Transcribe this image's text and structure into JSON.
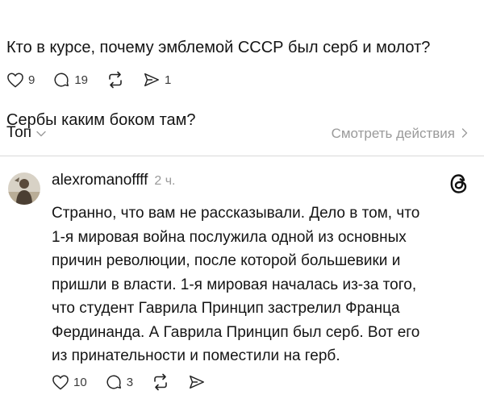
{
  "post": {
    "text_lines": [
      "Кто в курсе, почему эмблемой СССР был серб и молот?",
      "Сербы каким боком там?"
    ],
    "like_count": "9",
    "reply_count": "19",
    "share_count": "1"
  },
  "replies_header": {
    "sort_label": "Топ",
    "view_activity": "Смотреть действия"
  },
  "comment": {
    "username": "alexromanoffff",
    "timestamp": "2 ч.",
    "text_lines": [
      "Странно, что вам не рассказывали. Дело в том, что",
      "1-я мировая война послужила одной из основных",
      "причин революции, после которой большевики и",
      "пришли в власти. 1-я мировая началась из-за того,",
      "что студент Гаврила Принцип застрелил Франца",
      "Фердинанда. А Гаврила Принцип был серб. Вот его",
      "из принательности и поместили на герб."
    ],
    "like_count": "10",
    "reply_count": "3"
  },
  "icons": {
    "like": "heart-icon",
    "reply": "comment-bubble-icon",
    "repost": "repost-icon",
    "share": "send-icon",
    "threads": "threads-logo-icon",
    "chevron_down": "chevron-down-icon",
    "chevron_right": "chevron-right-icon"
  },
  "colors": {
    "text": "#141414",
    "muted": "#9a9a9a",
    "divider": "#d9d9d9"
  }
}
